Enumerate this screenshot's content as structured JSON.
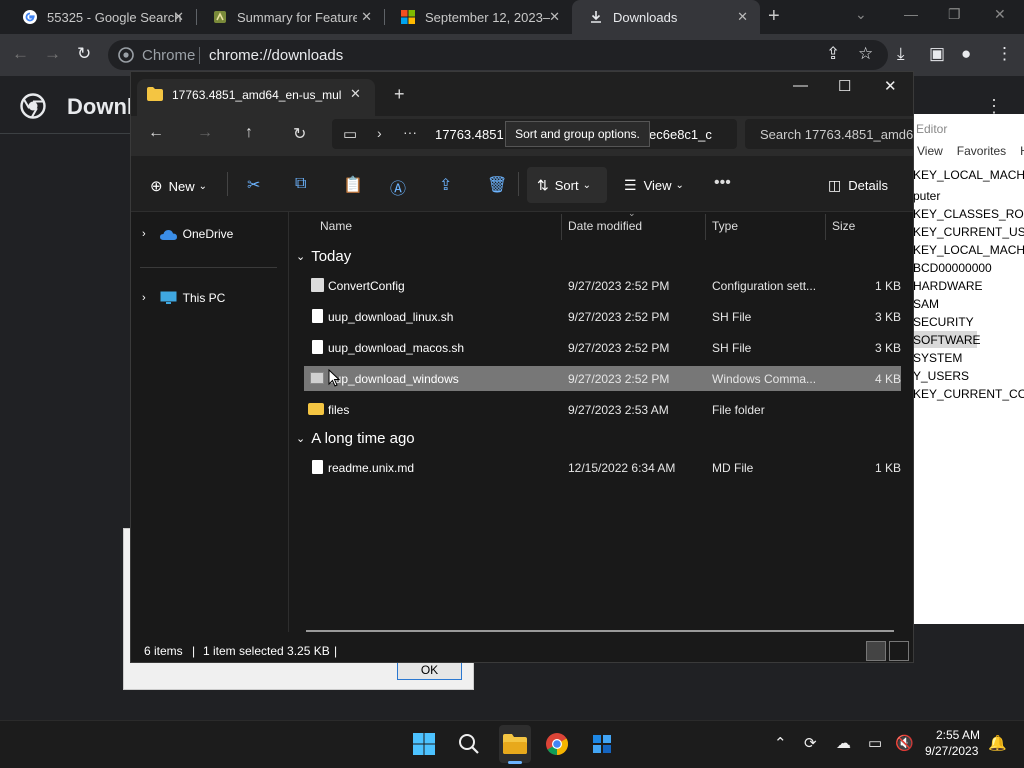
{
  "chrome": {
    "tabs": [
      {
        "title": "55325 - Google Search",
        "icon": "google-icon"
      },
      {
        "title": "Summary for Feature u",
        "icon": "uup-icon"
      },
      {
        "title": "September 12, 2023—",
        "icon": "microsoft-icon"
      },
      {
        "title": "Downloads",
        "icon": "download-icon"
      }
    ],
    "omnibox": {
      "site": "Chrome",
      "url": "chrome://downloads"
    },
    "page_title": "Downl"
  },
  "regedit": {
    "title": "Editor",
    "menu": [
      "View",
      "Favorites",
      "H"
    ],
    "rows": [
      "KEY_LOCAL_MACHIN",
      "puter",
      "KEY_CLASSES_ROOT",
      "KEY_CURRENT_USER",
      "KEY_LOCAL_MACHIN",
      "BCD00000000",
      "HARDWARE",
      "SAM",
      "SECURITY",
      "SOFTWARE",
      "SYSTEM",
      "Y_USERS",
      "KEY_CURRENT_CONF"
    ]
  },
  "dialog": {
    "ok_label": "OK"
  },
  "explorer": {
    "tab_title": "17763.4851_amd64_en-us_mul",
    "address": {
      "path_start": "17763.4851",
      "path_end": "ec6e8c1_c"
    },
    "tooltip": "Sort and group options.",
    "search_placeholder": "Search 17763.4851_amd6",
    "toolbar": {
      "new": "New",
      "sort": "Sort",
      "view": "View",
      "details": "Details"
    },
    "nav": [
      {
        "label": "OneDrive"
      },
      {
        "label": "This PC"
      }
    ],
    "columns": {
      "name": "Name",
      "date": "Date modified",
      "type": "Type",
      "size": "Size"
    },
    "groups": [
      {
        "label": "Today",
        "files": [
          {
            "name": "ConvertConfig",
            "date": "9/27/2023 2:52 PM",
            "type": "Configuration sett...",
            "size": "1 KB",
            "icon": "config-icon"
          },
          {
            "name": "uup_download_linux.sh",
            "date": "9/27/2023 2:52 PM",
            "type": "SH File",
            "size": "3 KB",
            "icon": "file-icon"
          },
          {
            "name": "uup_download_macos.sh",
            "date": "9/27/2023 2:52 PM",
            "type": "SH File",
            "size": "3 KB",
            "icon": "file-icon"
          },
          {
            "name": "uup_download_windows",
            "date": "9/27/2023 2:52 PM",
            "type": "Windows Comma...",
            "size": "4 KB",
            "icon": "cmd-icon",
            "selected": true
          },
          {
            "name": "files",
            "date": "9/27/2023 2:53 AM",
            "type": "File folder",
            "size": "",
            "icon": "folder-icon"
          }
        ]
      },
      {
        "label": "A long time ago",
        "files": [
          {
            "name": "readme.unix.md",
            "date": "12/15/2022 6:34 AM",
            "type": "MD File",
            "size": "1 KB",
            "icon": "file-icon"
          }
        ]
      }
    ],
    "status": {
      "items": "6 items",
      "selected": "1 item selected  3.25 KB"
    }
  },
  "taskbar": {
    "time": "2:55 AM",
    "date": "9/27/2023"
  },
  "colors": {
    "accent": "#6cb4ff",
    "folder": "#f4c542",
    "selection": "#777777"
  }
}
